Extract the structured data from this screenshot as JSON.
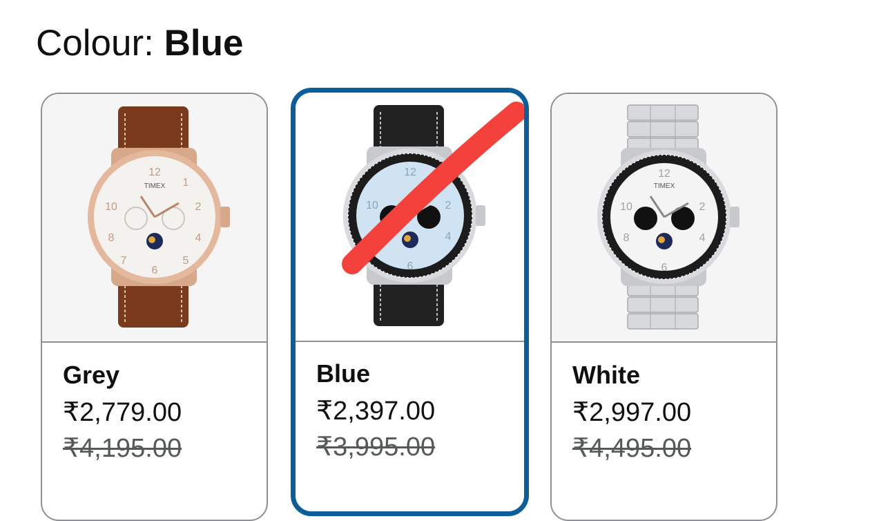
{
  "header": {
    "label": "Colour:",
    "selected_value": "Blue"
  },
  "variants": [
    {
      "name": "Grey",
      "price": "₹2,779.00",
      "mrp": "₹4,195.00",
      "strap": "brown leather",
      "case": "rose gold",
      "selected": false
    },
    {
      "name": "Blue",
      "price": "₹2,397.00",
      "mrp": "₹3,995.00",
      "strap": "black leather",
      "case": "silver",
      "selected": true
    },
    {
      "name": "White",
      "price": "₹2,997.00",
      "mrp": "₹4,495.00",
      "strap": "steel bracelet",
      "case": "silver",
      "selected": false
    }
  ],
  "watch_brand": "TIMEX",
  "colors": {
    "selected_border": "#0b5e9a",
    "card_border": "#8d9096",
    "mrp_text": "#565959",
    "annotation_stroke": "#f4413b"
  }
}
